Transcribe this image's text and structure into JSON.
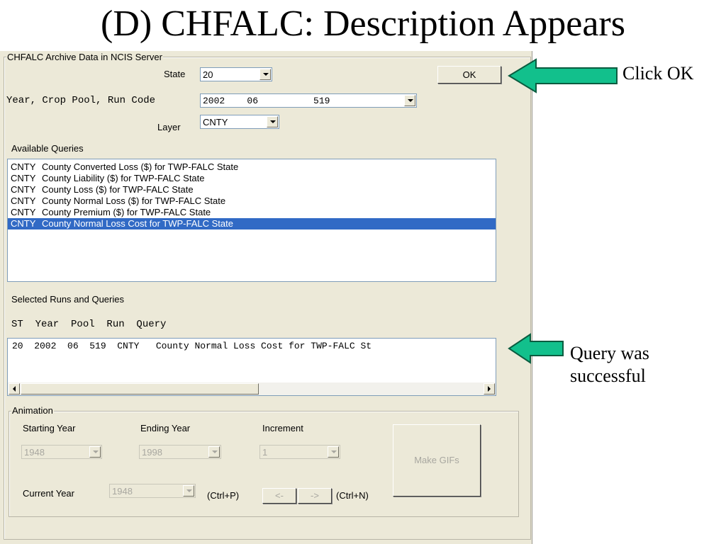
{
  "slide": {
    "title": "(D) CHFALC: Description Appears"
  },
  "dialog": {
    "group_title": "CHFALC Archive Data in NCIS Server",
    "state_label": "State",
    "state_value": "20",
    "ok_label": "OK",
    "year_label": "Year, Crop Pool, Run Code",
    "year_value": "2002    06          519",
    "layer_label": "Layer",
    "layer_value": "CNTY",
    "available_label": "Available Queries",
    "queries": [
      {
        "code": "CNTY",
        "text": "County Converted Loss ($) for TWP-FALC State"
      },
      {
        "code": "CNTY",
        "text": "County Liability ($) for TWP-FALC State"
      },
      {
        "code": "CNTY",
        "text": "County Loss ($) for TWP-FALC State"
      },
      {
        "code": "CNTY",
        "text": "County Normal Loss ($) for TWP-FALC State"
      },
      {
        "code": "CNTY",
        "text": "County Premium ($) for TWP-FALC State"
      },
      {
        "code": "CNTY",
        "text": "County Normal Loss Cost for TWP-FALC State"
      }
    ],
    "selected_label": "Selected Runs and Queries",
    "runs_header": "ST  Year  Pool  Run  Query",
    "runs": [
      "20  2002  06  519  CNTY   County Normal Loss Cost for TWP-FALC St"
    ]
  },
  "animation": {
    "group_title": "Animation",
    "start_label": "Starting Year",
    "start_value": "1948",
    "end_label": "Ending Year",
    "end_value": "1998",
    "increment_label": "Increment",
    "increment_value": "1",
    "current_label": "Current Year",
    "current_value": "1948",
    "ctrl_p": "(Ctrl+P)",
    "prev_label": "<-",
    "next_label": "->",
    "ctrl_n": "(Ctrl+N)",
    "make_gifs_label": "Make GIFs"
  },
  "callouts": {
    "click_ok": "Click OK",
    "query_line1": "Query was",
    "query_line2": "successful"
  },
  "colors": {
    "arrow_fill": "#12c08c",
    "selection": "#316ac5",
    "dialog_bg": "#ece9d8"
  }
}
